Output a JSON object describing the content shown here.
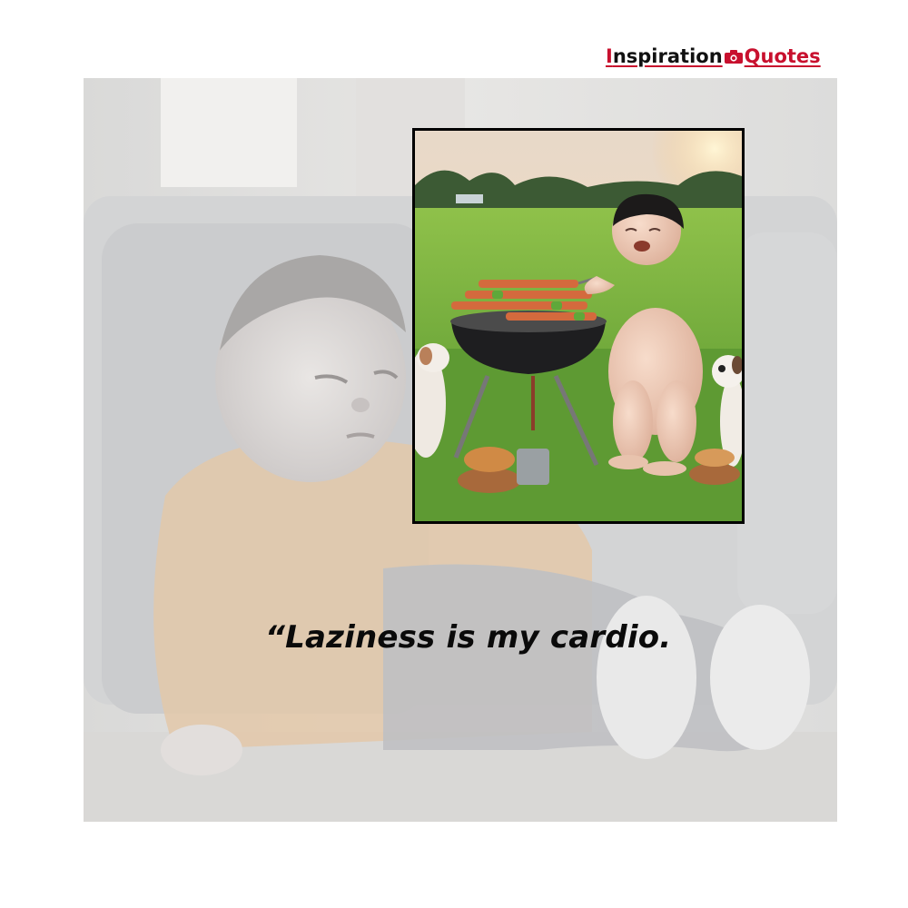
{
  "brand": {
    "part1": "I",
    "part2": "nspiration",
    "part3": "Quotes",
    "logo_icon": "camera-icon",
    "accent_color": "#c8102e"
  },
  "background_image": {
    "subject": "faded photo of child resting on sofa",
    "tint": "#e6e6e6"
  },
  "featured_image": {
    "subject": "child grilling skewers with puppies on grass"
  },
  "quote": {
    "text": "“Laziness is my cardio."
  }
}
